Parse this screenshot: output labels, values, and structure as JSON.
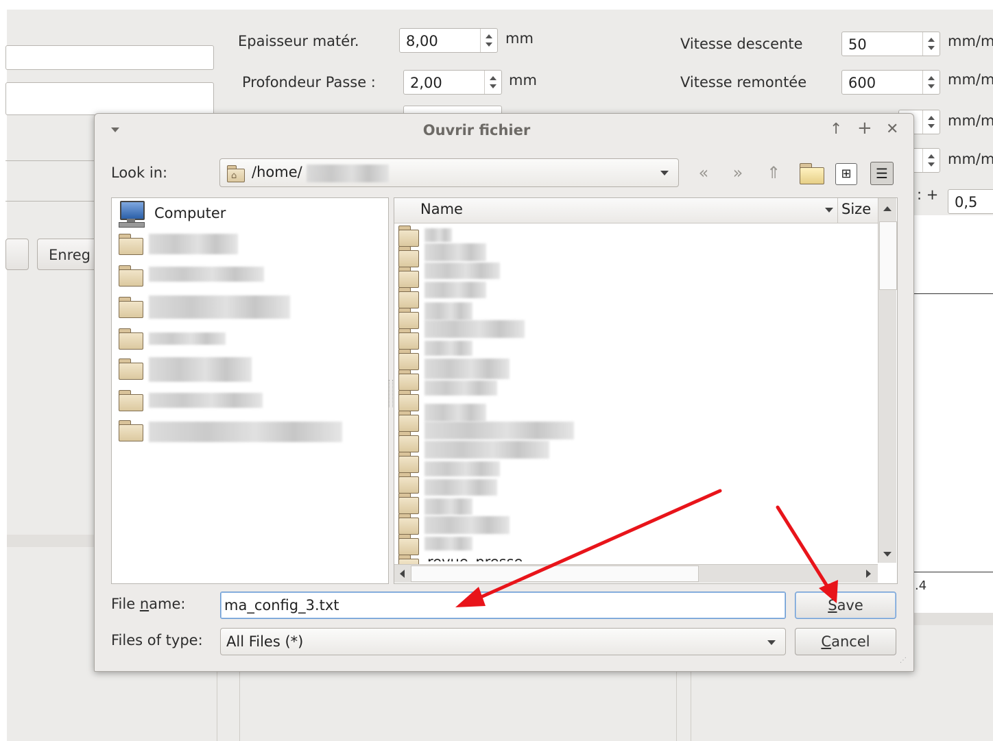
{
  "background": {
    "fields": [
      {
        "label": "Epaisseur matér.",
        "value": "8,00",
        "unit": "mm"
      },
      {
        "label": "Profondeur Passe :",
        "value": "2,00",
        "unit": "mm"
      }
    ],
    "speeds": [
      {
        "label": "Vitesse descente",
        "value": "50",
        "unit": "mm/m"
      },
      {
        "label": "Vitesse remontée",
        "value": "600",
        "unit": "mm/m"
      }
    ],
    "extra_units": [
      "mm/m",
      "mm/m"
    ],
    "offset_label": ": +",
    "offset_value": "0,5",
    "button_label": "Enreg",
    "axis_tick": ".4"
  },
  "dialog": {
    "title": "Ouvrir fichier",
    "titlebar_icons": [
      "menu-icon",
      "up-arrow-icon",
      "plus-icon",
      "close-icon"
    ],
    "look_in_label": "Look in:",
    "look_in_path": "/home/",
    "sidebar": {
      "items": [
        {
          "label": "Computer",
          "icon": "computer-icon"
        }
      ]
    },
    "columns": {
      "name": "Name",
      "size": "Size"
    },
    "partial_file": "revue_presse",
    "file_name_label_pre": "File ",
    "file_name_label_u": "n",
    "file_name_label_post": "ame:",
    "file_name_value": "ma_config_3.txt",
    "files_of_type_label": "Files of type:",
    "files_of_type_value": "All Files (*)",
    "save_u": "S",
    "save_rest": "ave",
    "cancel_u": "C",
    "cancel_rest": "ancel"
  },
  "annotation_color": "#e8141a"
}
